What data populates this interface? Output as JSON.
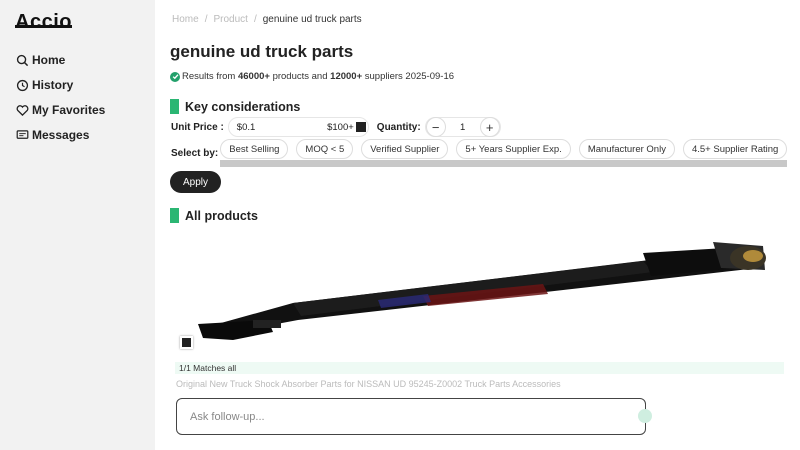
{
  "sidebar": {
    "logo": "Accio",
    "items": [
      {
        "label": "Home",
        "icon": "search-icon"
      },
      {
        "label": "History",
        "icon": "history-icon"
      },
      {
        "label": "My Favorites",
        "icon": "heart-icon"
      },
      {
        "label": "Messages",
        "icon": "messages-icon"
      }
    ]
  },
  "breadcrumb": {
    "home": "Home",
    "sep": "/",
    "product": "Product",
    "current": "genuine ud truck parts"
  },
  "page": {
    "title": "genuine ud truck parts",
    "results_prefix": "Results from ",
    "products_count": "46000+",
    "products_text": " products and ",
    "suppliers_count": "12000+",
    "suppliers_text": " suppliers 2025-09-16"
  },
  "considerations": {
    "heading": "Key considerations",
    "unit_price_label": "Unit Price :",
    "price_min": "$0.1",
    "price_max": "$100+",
    "quantity_label": "Quantity:",
    "quantity_value": "1",
    "minus": "−",
    "plus": "+",
    "select_by_label": "Select by:",
    "chips": [
      "Best Selling",
      "MOQ < 5",
      "Verified Supplier",
      "5+ Years Supplier Exp.",
      "Manufacturer Only",
      "4.5+ Supplier Rating"
    ],
    "apply_label": "Apply"
  },
  "products": {
    "heading": "All products",
    "items": [
      {
        "matches": "1/1 Matches all",
        "title": "Original New Truck Shock Absorber Parts for NISSAN UD 95245-Z0002 Truck Parts Accessories"
      }
    ]
  },
  "followup": {
    "placeholder": "Ask follow-up..."
  },
  "colors": {
    "accent_green": "#2bb673",
    "dark": "#222222",
    "sidebar_bg": "#f2f2f2"
  }
}
